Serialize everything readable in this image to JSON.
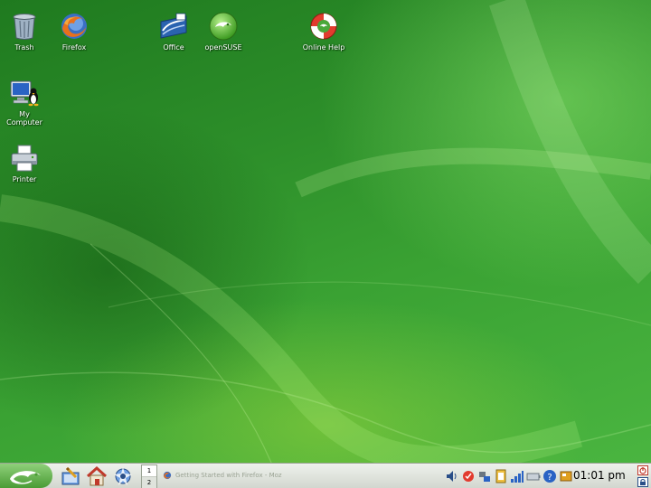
{
  "desktop": {
    "icons": [
      {
        "label": "Trash",
        "icon": "trash-icon"
      },
      {
        "label": "Firefox",
        "icon": "firefox-icon"
      },
      {
        "label": "Office",
        "icon": "office-icon"
      },
      {
        "label": "openSUSE",
        "icon": "opensuse-icon"
      },
      {
        "label": "Online Help",
        "icon": "help-lifebuoy-icon"
      },
      {
        "label": "My\nComputer",
        "icon": "computer-icon"
      },
      {
        "label": "Printer",
        "icon": "printer-icon"
      }
    ]
  },
  "taskbar": {
    "start_icon": "opensuse-gecko-icon",
    "quick_launch": [
      "control-center-icon",
      "home-folder-icon",
      "konqueror-icon"
    ],
    "pager": {
      "desktops": [
        "1",
        "2"
      ],
      "active": "1"
    },
    "task": {
      "label": "Getting Started with Firefox - Moz",
      "icon": "firefox-icon"
    },
    "tray": [
      "volume-icon",
      "update-icon",
      "network-icon",
      "klipper-icon",
      "signal-icon",
      "battery-icon",
      "help-icon",
      "suse-hardware-icon"
    ],
    "clock": "01:01 pm",
    "logout_icon": "logout-icon",
    "lock_icon": "lock-screen-icon"
  },
  "colors": {
    "desktop_green": "#2f8f2a",
    "taskbar_bg": "#e2e6df",
    "label_text": "#ffffff"
  }
}
